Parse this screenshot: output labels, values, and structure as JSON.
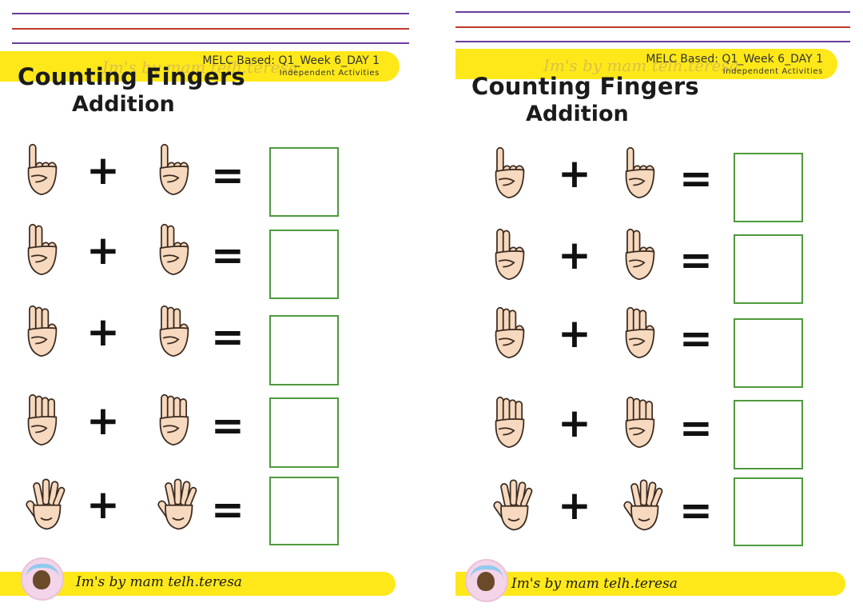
{
  "worksheet": {
    "meta_line1": "MELC Based: Q1_Week 6_DAY 1",
    "meta_line2": "Independent Activities",
    "title_line1": "Counting Fingers",
    "title_line2": "Addition",
    "watermark": "Im's by mam telh.teresa",
    "signature": "Im's by mam telh.teresa",
    "plus_sign": "+",
    "equals_sign": "=",
    "colors": {
      "banner": "#ffe81a",
      "answer_box": "#4f9a3d",
      "rule_purple": "#6a3d9a",
      "rule_red": "#c0392b"
    },
    "problems": [
      {
        "a": 1,
        "b": 1
      },
      {
        "a": 2,
        "b": 2
      },
      {
        "a": 3,
        "b": 3
      },
      {
        "a": 4,
        "b": 4
      },
      {
        "a": 5,
        "b": 5
      }
    ]
  }
}
